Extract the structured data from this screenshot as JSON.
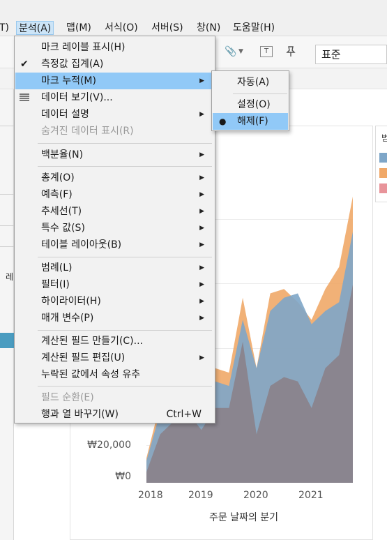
{
  "menubar": {
    "items": [
      "T)",
      "분석(A)",
      "맵(M)",
      "서식(O)",
      "서버(S)",
      "창(N)",
      "도움말(H)"
    ]
  },
  "toolbar": {
    "text_box_label": "T",
    "format_select": "표준"
  },
  "analysis_menu": {
    "items": [
      {
        "label": "마크 레이블 표시(H)",
        "checked": false,
        "submenu": false,
        "enabled": true
      },
      {
        "label": "측정값 집계(A)",
        "checked": true,
        "submenu": false,
        "enabled": true
      },
      {
        "label": "마크 누적(M)",
        "checked": false,
        "submenu": true,
        "enabled": true,
        "highlighted": true
      },
      {
        "label": "데이터 보기(V)...",
        "submenu": false,
        "enabled": true,
        "icon": "data-grid-icon"
      },
      {
        "label": "데이터 설명",
        "submenu": true,
        "enabled": true
      },
      {
        "label": "숨겨진 데이터 표시(R)",
        "submenu": false,
        "enabled": false
      },
      {
        "label": "백분율(N)",
        "submenu": true,
        "enabled": true
      },
      {
        "label": "총계(O)",
        "submenu": true,
        "enabled": true
      },
      {
        "label": "예측(F)",
        "submenu": true,
        "enabled": true
      },
      {
        "label": "추세선(T)",
        "submenu": true,
        "enabled": true
      },
      {
        "label": "특수 값(S)",
        "submenu": true,
        "enabled": true
      },
      {
        "label": "테이블 레이아웃(B)",
        "submenu": true,
        "enabled": true
      },
      {
        "label": "범례(L)",
        "submenu": true,
        "enabled": true
      },
      {
        "label": "필터(I)",
        "submenu": true,
        "enabled": true
      },
      {
        "label": "하이라이터(H)",
        "submenu": true,
        "enabled": true
      },
      {
        "label": "매개 변수(P)",
        "submenu": true,
        "enabled": true
      },
      {
        "label": "계산된 필드 만들기(C)...",
        "submenu": false,
        "enabled": true
      },
      {
        "label": "계산된 필드 편집(U)",
        "submenu": true,
        "enabled": true
      },
      {
        "label": "누락된 값에서 속성 유추",
        "submenu": false,
        "enabled": true
      },
      {
        "label": "필드 순환(E)",
        "submenu": false,
        "enabled": false
      },
      {
        "label": "행과 열 바꾸기(W)",
        "submenu": false,
        "enabled": true,
        "shortcut": "Ctrl+W"
      }
    ]
  },
  "stack_submenu": {
    "items": [
      {
        "label": "자동(A)",
        "selected": false
      },
      {
        "label": "설정(O)",
        "selected": false
      },
      {
        "label": "해제(F)",
        "selected": true
      }
    ]
  },
  "chart": {
    "legend_title_fragment": "범",
    "colors": [
      "#7ea6c8",
      "#f0a868",
      "#e8949a"
    ],
    "y_ticks": [
      "₩20,000",
      "₩0"
    ],
    "x_ticks": [
      "2018",
      "2019",
      "2020",
      "2021"
    ],
    "x_label": "주문 날짜의 분기"
  },
  "left_pane": {
    "text_fragment": "레"
  },
  "chart_data": {
    "type": "area",
    "xlabel": "주문 날짜의 분기",
    "ylabel": "",
    "x": [
      "2018 Q1",
      "2018 Q2",
      "2018 Q3",
      "2018 Q4",
      "2019 Q1",
      "2019 Q2",
      "2019 Q3",
      "2019 Q4",
      "2020 Q1",
      "2020 Q2",
      "2020 Q3",
      "2020 Q4",
      "2021 Q1",
      "2021 Q2",
      "2021 Q3",
      "2021 Q4"
    ],
    "series": [
      {
        "color": "#f0a868",
        "values": [
          28000,
          90000,
          105000,
          125000,
          105000,
          130000,
          125000,
          210000,
          130000,
          215000,
          220000,
          205000,
          185000,
          220000,
          245000,
          325000
        ]
      },
      {
        "color": "#7ea6c8",
        "values": [
          25000,
          80000,
          90000,
          100000,
          95000,
          115000,
          110000,
          185000,
          130000,
          195000,
          210000,
          215000,
          180000,
          195000,
          205000,
          285000
        ]
      },
      {
        "color": "#8a7f86",
        "values": [
          12000,
          55000,
          70000,
          80000,
          60000,
          85000,
          85000,
          160000,
          55000,
          110000,
          120000,
          115000,
          85000,
          130000,
          145000,
          225000
        ]
      }
    ],
    "ylim": [
      0,
      350000
    ],
    "grid": true,
    "legend_position": "right"
  }
}
